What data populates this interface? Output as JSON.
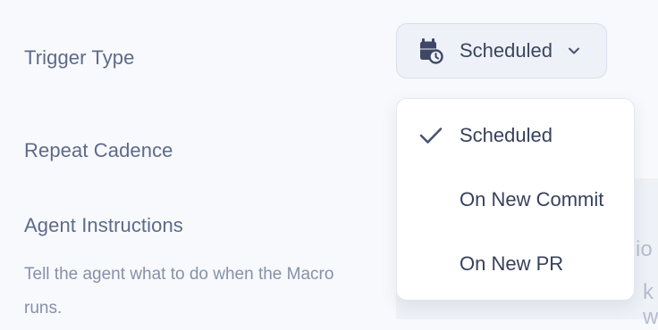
{
  "form": {
    "trigger_type_label": "Trigger Type",
    "repeat_cadence_label": "Repeat Cadence",
    "agent_instructions_label": "Agent Instructions",
    "agent_instructions_desc": "Tell the agent what to do when the Macro runs."
  },
  "trigger_select": {
    "selected_value": "Scheduled",
    "icon": "calendar-clock-icon",
    "options": [
      {
        "label": "Scheduled",
        "selected": true
      },
      {
        "label": "On New Commit",
        "selected": false
      },
      {
        "label": "On New PR",
        "selected": false
      }
    ]
  },
  "colors": {
    "background": "#f8f9fc",
    "label_text": "#5d6a8a",
    "select_bg": "#eef1f7",
    "select_border": "#d9deea",
    "option_text": "#37415c",
    "check": "#4a5470"
  }
}
